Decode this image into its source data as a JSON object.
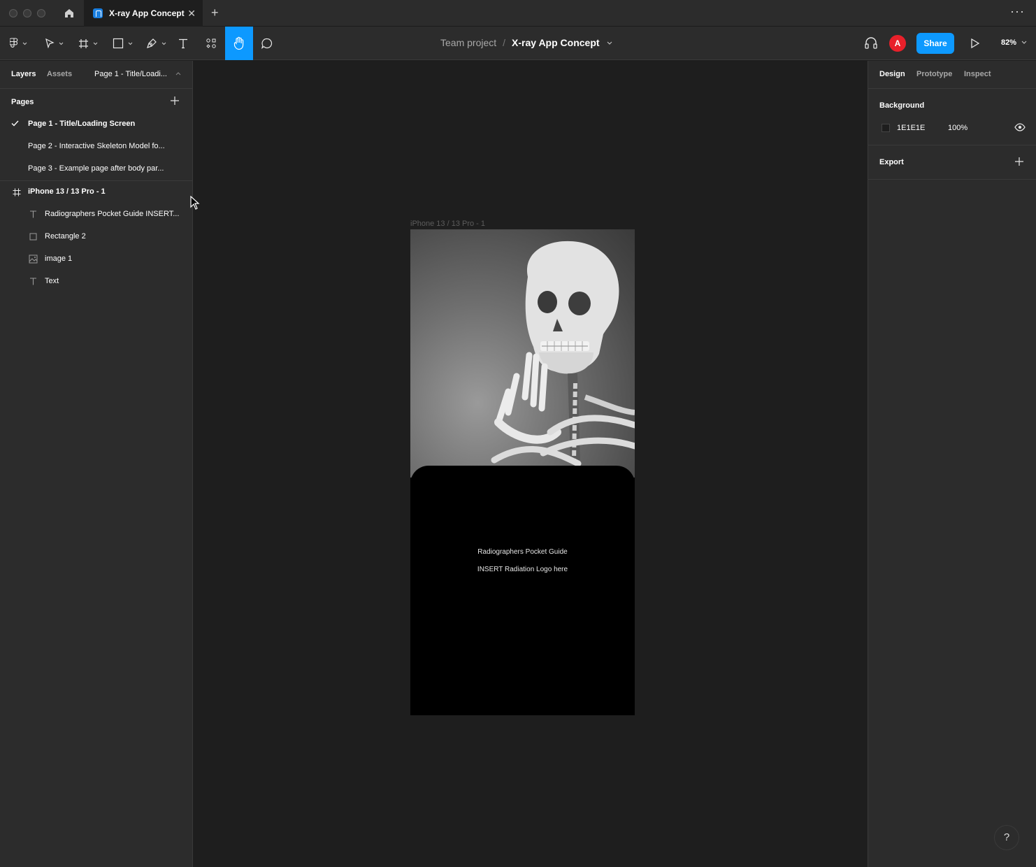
{
  "titlebar": {
    "tab_title": "X-ray App Concept",
    "tab_close": "✕",
    "new_tab": "+",
    "more": "···"
  },
  "toolbar": {
    "breadcrumb_team": "Team project",
    "breadcrumb_separator": "/",
    "breadcrumb_file": "X-ray App Concept",
    "avatar_initial": "A",
    "share_label": "Share",
    "zoom": "82%",
    "active_tool": "hand",
    "accent_color": "#0d99ff"
  },
  "left_panel": {
    "tabs": [
      "Layers",
      "Assets"
    ],
    "page_selector": "Page 1 - Title/Loadi...",
    "pages_title": "Pages",
    "pages": [
      {
        "label": "Page 1 - Title/Loading Screen",
        "selected": true
      },
      {
        "label": "Page 2 - Interactive Skeleton Model fo...",
        "selected": false
      },
      {
        "label": "Page 3 - Example page after body par...",
        "selected": false
      }
    ],
    "frame_layer": "iPhone 13 / 13 Pro - 1",
    "layers": [
      {
        "label": "Radiographers Pocket Guide INSERT...",
        "icon": "text-icon"
      },
      {
        "label": "Rectangle 2",
        "icon": "rectangle-icon"
      },
      {
        "label": "image 1",
        "icon": "image-icon"
      },
      {
        "label": "Text",
        "icon": "text-icon"
      }
    ]
  },
  "canvas": {
    "frame_label": "iPhone 13 / 13 Pro - 1",
    "title_text": "Radiographers Pocket Guide",
    "subtitle_text": "INSERT Radiation Logo here"
  },
  "right_panel": {
    "tabs": [
      "Design",
      "Prototype",
      "Inspect"
    ],
    "background_title": "Background",
    "background_hex": "1E1E1E",
    "background_opacity": "100%",
    "export_title": "Export"
  },
  "help_label": "?"
}
